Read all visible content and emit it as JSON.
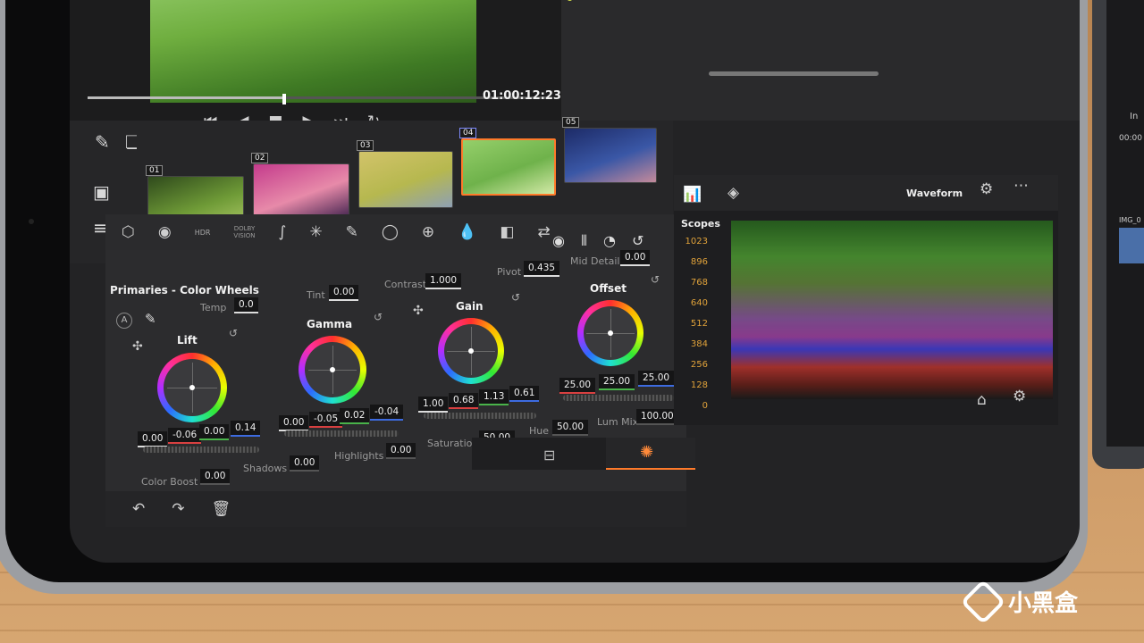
{
  "viewer": {
    "timecode": "01:00:12:23"
  },
  "node": {
    "label": "01"
  },
  "clips": [
    {
      "num": "01",
      "selected": false,
      "colors": [
        "#2f4a1c",
        "#6f9b37",
        "#b2cc6a"
      ]
    },
    {
      "num": "02",
      "selected": false,
      "colors": [
        "#c43b8c",
        "#e78aa9",
        "#3b1f4b"
      ]
    },
    {
      "num": "03",
      "selected": false,
      "colors": [
        "#d2c36a",
        "#b6b84f",
        "#8ea0b4"
      ]
    },
    {
      "num": "04",
      "selected": true,
      "colors": [
        "#95cf6a",
        "#6fb24b",
        "#d2e9a6"
      ]
    },
    {
      "num": "05",
      "selected": false,
      "colors": [
        "#1d2b67",
        "#3a57a6",
        "#c48a9b"
      ]
    }
  ],
  "palette": {
    "dolby_line1": "DOLBY",
    "dolby_line2": "VISION",
    "hdr": "HDR"
  },
  "primaries": {
    "title": "Primaries - Color Wheels",
    "temp_label": "Temp",
    "temp": "0.0",
    "tint_label": "Tint",
    "tint": "0.00",
    "contrast_label": "Contrast",
    "contrast": "1.000",
    "pivot_label": "Pivot",
    "pivot": "0.435",
    "middetail_label": "Mid Detail",
    "middetail": "0.00",
    "auto_label": "A",
    "wheels": {
      "lift": {
        "label": "Lift",
        "values": [
          "0.00",
          "-0.06",
          "0.00",
          "0.14"
        ]
      },
      "gamma": {
        "label": "Gamma",
        "values": [
          "0.00",
          "-0.05",
          "0.02",
          "-0.04"
        ]
      },
      "gain": {
        "label": "Gain",
        "values": [
          "1.00",
          "0.68",
          "1.13",
          "0.61"
        ]
      },
      "offset": {
        "label": "Offset",
        "values": [
          "25.00",
          "25.00",
          "25.00"
        ]
      }
    },
    "colorboost_label": "Color Boost",
    "colorboost": "0.00",
    "shadows_label": "Shadows",
    "shadows": "0.00",
    "highlights_label": "Highlights",
    "highlights": "0.00",
    "saturation_label": "Saturation",
    "saturation": "50.00",
    "hue_label": "Hue",
    "hue": "50.00",
    "lummix_label": "Lum Mix",
    "lummix": "100.00"
  },
  "scopes": {
    "title": "Scopes",
    "mode": "Waveform",
    "ticks": [
      "1023",
      "896",
      "768",
      "640",
      "512",
      "384",
      "256",
      "128",
      "0"
    ]
  },
  "right_device": {
    "line1": "In",
    "line2": "00:00",
    "clip": "IMG_0"
  },
  "watermark": {
    "text": "小黑盒"
  }
}
